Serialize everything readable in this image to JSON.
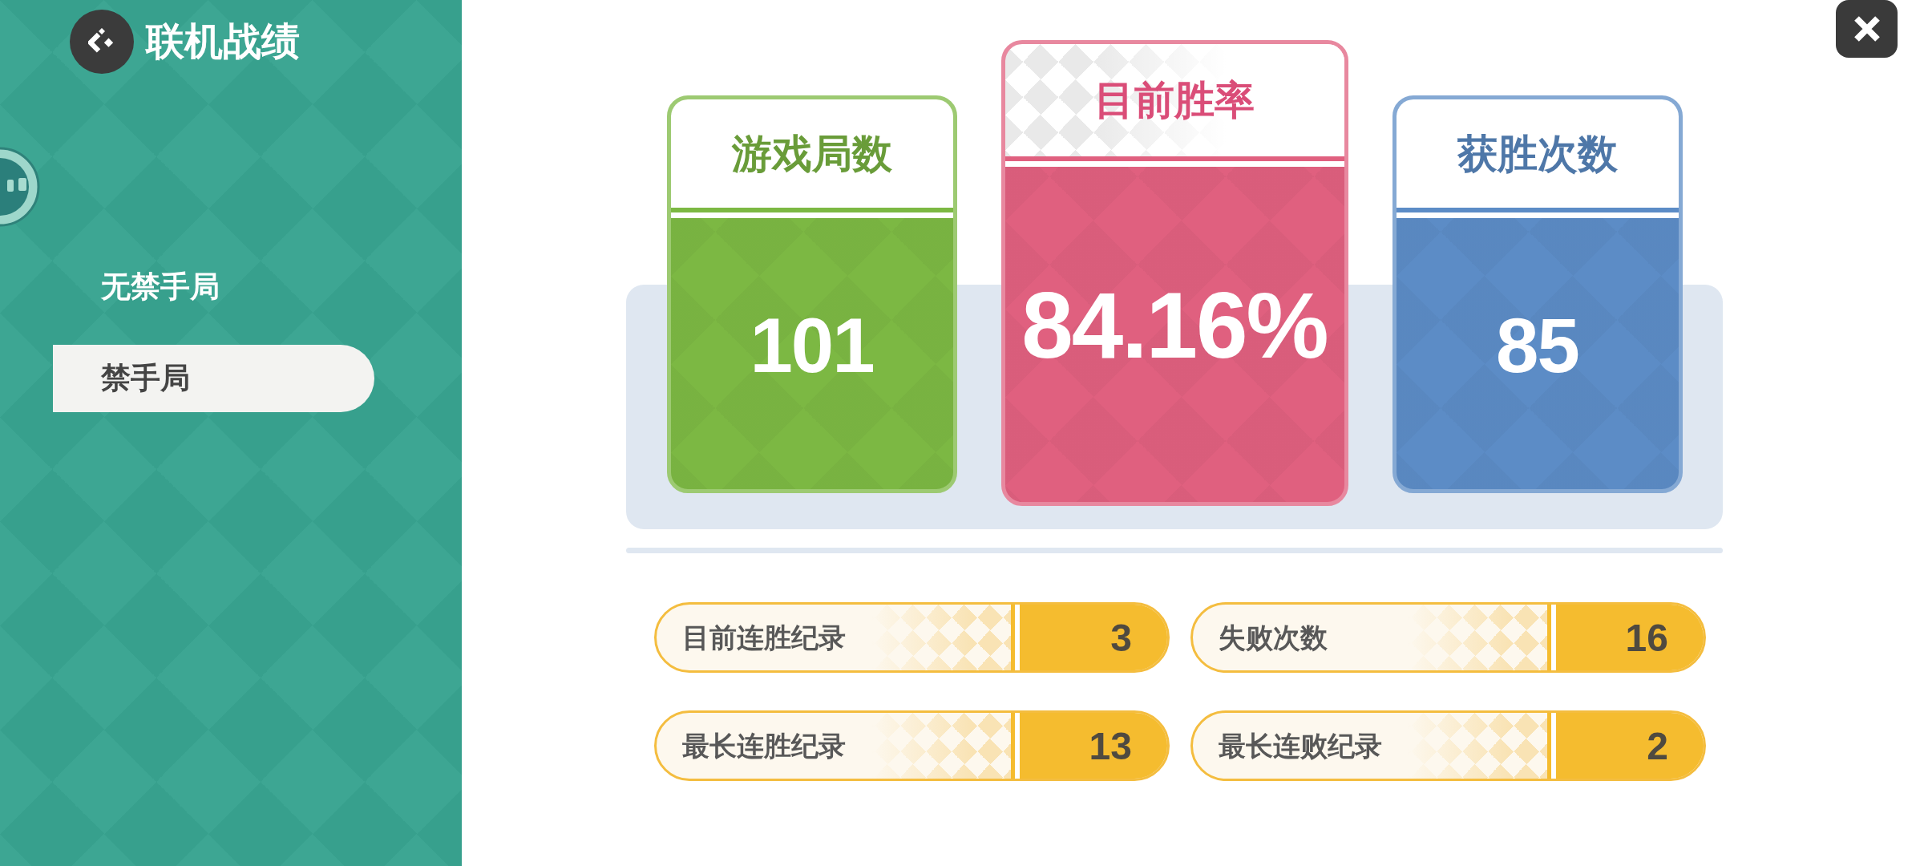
{
  "header": {
    "title": "联机战绩"
  },
  "sidebar": {
    "items": [
      {
        "label": "无禁手局",
        "selected": false
      },
      {
        "label": "禁手局",
        "selected": true
      }
    ]
  },
  "cards": [
    {
      "kind": "standard",
      "title": "游戏局数",
      "value": "101",
      "color": "#7cb843"
    },
    {
      "kind": "featured",
      "title": "目前胜率",
      "value": "84.16%",
      "color": "#e0607f"
    },
    {
      "kind": "standard",
      "title": "获胜次数",
      "value": "85",
      "color": "#5c8cc6"
    }
  ],
  "records": [
    {
      "label": "目前连胜纪录",
      "value": "3"
    },
    {
      "label": "失败次数",
      "value": "16"
    },
    {
      "label": "最长连胜纪录",
      "value": "13"
    },
    {
      "label": "最长连败纪录",
      "value": "2"
    }
  ]
}
